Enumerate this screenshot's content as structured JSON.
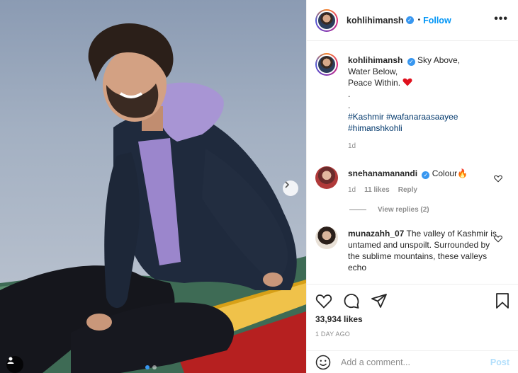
{
  "post": {
    "username": "kohlihimansh",
    "follow_label": "Follow",
    "more_label": "•••",
    "separator": "•"
  },
  "caption": {
    "username": "kohlihimansh",
    "line1": "Sky Above,",
    "line2": "Water Below,",
    "line3": "Peace Within.",
    "dot1": ".",
    "dot2": ".",
    "hashtags1": "#Kashmir #wafanaraasaayee",
    "hashtags2": "#himanshkohli",
    "time": "1d"
  },
  "comments": [
    {
      "username": "snehanamanandi",
      "text": "Colour",
      "emoji": "🔥",
      "time": "1d",
      "likes": "11 likes",
      "reply_label": "Reply",
      "view_replies": "View replies (2)"
    },
    {
      "username": "munazahh_07",
      "text": "The valley of Kashmir is untamed and unspoilt. Surrounded by the sublime mountains, these valleys echo"
    }
  ],
  "stats": {
    "likes": "33,934 likes",
    "time_ago": "1 DAY AGO"
  },
  "comment_box": {
    "placeholder": "Add a comment...",
    "post_label": "Post"
  },
  "colors": {
    "accent": "#0095f6",
    "verified": "#3897f0",
    "heart": "#ed4956",
    "hashtag": "#00376b"
  },
  "carousel": {
    "current": 1,
    "total": 2
  }
}
